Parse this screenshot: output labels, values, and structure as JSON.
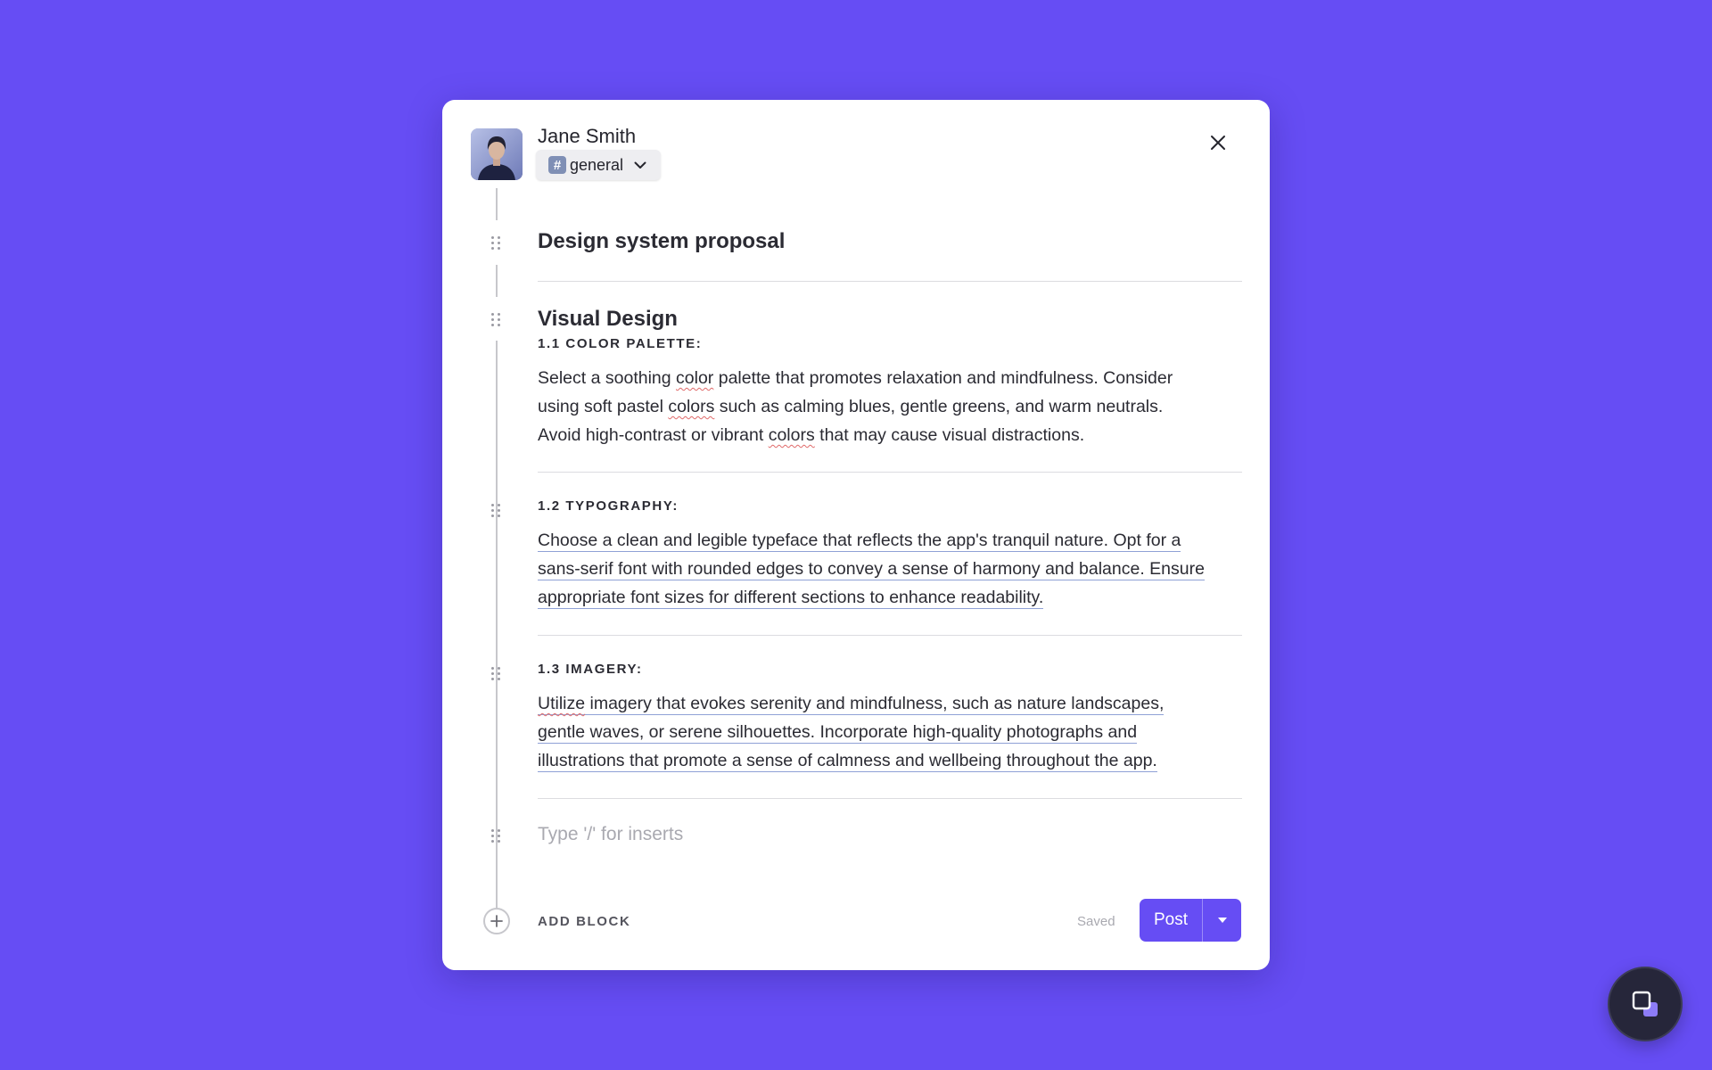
{
  "author": {
    "name": "Jane Smith",
    "avatar_icon": "user-photo"
  },
  "channel": {
    "prefix": "#",
    "name": "general",
    "icon": "chevron-down-icon"
  },
  "document": {
    "title": "Design system proposal",
    "section_heading": "Visual Design",
    "blocks": [
      {
        "heading": "1.1 COLOR PALETTE:",
        "lines": [
          [
            "Select a soothing ",
            {
              "spell": "color"
            },
            " palette that promotes relaxation and mindfulness. Consider"
          ],
          [
            "using soft pastel ",
            {
              "spell": "colors"
            },
            " such as calming blues, gentle greens, and warm neutrals."
          ],
          [
            "Avoid high-contrast or vibrant ",
            {
              "spell": "colors"
            },
            " that may cause visual distractions."
          ]
        ]
      },
      {
        "heading": "1.2 TYPOGRAPHY:",
        "lines": [
          "Choose a clean and legible typeface that reflects the app's tranquil nature. Opt for a",
          "sans-serif font with rounded edges to convey a sense of harmony and balance. Ensure",
          "appropriate font sizes for different sections to enhance readability."
        ]
      },
      {
        "heading": "1.3 IMAGERY:",
        "lines": [
          [
            {
              "spell": "Utilize"
            },
            " imagery that evokes serenity and mindfulness, such as nature landscapes,"
          ],
          "gentle waves, or serene silhouettes. Incorporate high-quality photographs and",
          "illustrations that promote a sense of calmness and wellbeing throughout the app."
        ]
      }
    ],
    "placeholder": "Type '/' for inserts"
  },
  "footer": {
    "add_block_label": "ADD BLOCK",
    "status": "Saved",
    "post_label": "Post"
  },
  "colors": {
    "accent": "#664df4",
    "background": "#664df4",
    "fab": "#26263a"
  }
}
